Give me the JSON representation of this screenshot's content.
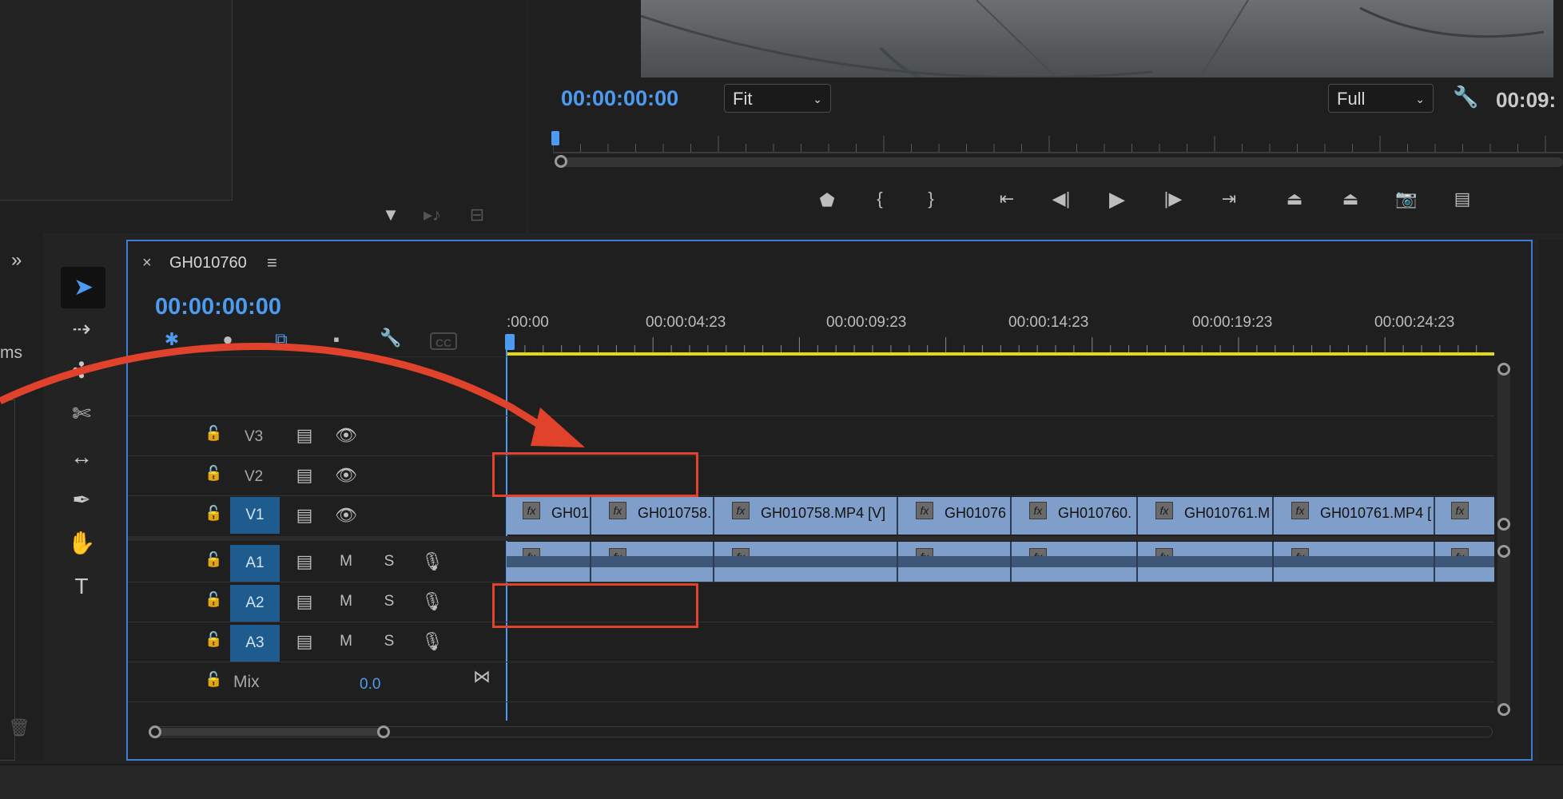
{
  "project_panel": {
    "side_label": "ms",
    "bottom_icons": [
      "filter-icon",
      "automate-icon",
      "new-bin-icon"
    ]
  },
  "program_monitor": {
    "timecode": "00:00:00:00",
    "fit_select": "Fit",
    "quality_select": "Full",
    "duration": "00:09:",
    "transport_icons": [
      "marker-icon",
      "mark-in-icon",
      "mark-out-icon",
      "go-to-in-icon",
      "step-back-icon",
      "play-icon",
      "step-forward-icon",
      "go-to-out-icon",
      "lift-icon",
      "extract-icon",
      "camera-icon",
      "compare-icon"
    ]
  },
  "timeline": {
    "sequence_name": "GH010760",
    "timecode": "00:00:00:00",
    "ruler_labels": [
      ":00:00",
      "00:00:04:23",
      "00:00:09:23",
      "00:00:14:23",
      "00:00:19:23",
      "00:00:24:23"
    ],
    "tracks": {
      "v3": "V3",
      "v2": "V2",
      "v1": "V1",
      "a1": "A1",
      "a2": "A2",
      "a3": "A3",
      "mix": "Mix",
      "mix_value": "0.0",
      "mute": "M",
      "solo": "S"
    },
    "video_clips": [
      "GH01",
      "GH010758.",
      "GH010758.MP4 [V]",
      "GH01076",
      "GH010760.",
      "GH010761.M",
      "GH010761.MP4 [",
      ""
    ],
    "fx_label": "fx",
    "cc_label": "CC"
  },
  "colors": {
    "accent_blue": "#4d9bf0",
    "clip_blue": "#7f9ec9",
    "annotation_red": "#e0422c",
    "track_target": "#1e5c8f"
  }
}
